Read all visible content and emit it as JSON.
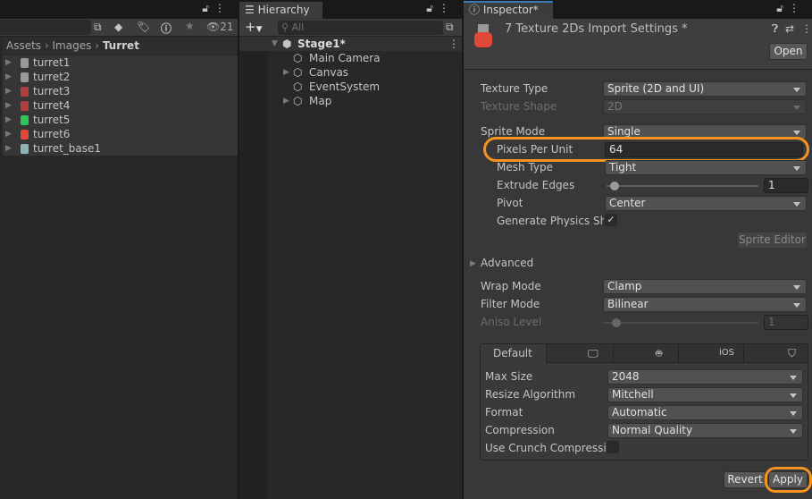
{
  "project": {
    "search_value": "",
    "hidden_count": "21",
    "breadcrumb": [
      "Assets",
      "Images",
      "Turret"
    ],
    "items": [
      {
        "label": "turret1",
        "color": "#9a9a9a"
      },
      {
        "label": "turret2",
        "color": "#9a9a9a"
      },
      {
        "label": "turret3",
        "color": "#b04040"
      },
      {
        "label": "turret4",
        "color": "#b04040"
      },
      {
        "label": "turret5",
        "color": "#2ec458"
      },
      {
        "label": "turret6",
        "color": "#e0483a"
      },
      {
        "label": "turret_base1",
        "color": "#8fb3b3"
      }
    ]
  },
  "hierarchy": {
    "tab": "Hierarchy",
    "search_placeholder": "All",
    "scene": "Stage1*",
    "objects": [
      {
        "label": "Main Camera",
        "expandable": false
      },
      {
        "label": "Canvas",
        "expandable": true
      },
      {
        "label": "EventSystem",
        "expandable": false
      },
      {
        "label": "Map",
        "expandable": true
      }
    ]
  },
  "inspector": {
    "tab": "Inspector*",
    "title": "7 Texture 2Ds Import Settings *",
    "open": "Open",
    "texture_type": {
      "label": "Texture Type",
      "value": "Sprite (2D and UI)"
    },
    "texture_shape": {
      "label": "Texture Shape",
      "value": "2D"
    },
    "sprite_mode": {
      "label": "Sprite Mode",
      "value": "Single"
    },
    "ppu": {
      "label": "Pixels Per Unit",
      "value": "64"
    },
    "mesh_type": {
      "label": "Mesh Type",
      "value": "Tight"
    },
    "extrude": {
      "label": "Extrude Edges",
      "value": "1"
    },
    "pivot": {
      "label": "Pivot",
      "value": "Center"
    },
    "physics": {
      "label": "Generate Physics Shape",
      "checked": true
    },
    "sprite_editor": "Sprite Editor",
    "advanced": "Advanced",
    "wrap": {
      "label": "Wrap Mode",
      "value": "Clamp"
    },
    "filter": {
      "label": "Filter Mode",
      "value": "Bilinear"
    },
    "aniso": {
      "label": "Aniso Level",
      "value": "1"
    },
    "platform_tabs": [
      "Default",
      "standalone-icon",
      "android-icon",
      "iOS",
      "webgl-icon"
    ],
    "max_size": {
      "label": "Max Size",
      "value": "2048"
    },
    "resize": {
      "label": "Resize Algorithm",
      "value": "Mitchell"
    },
    "format": {
      "label": "Format",
      "value": "Automatic"
    },
    "compression": {
      "label": "Compression",
      "value": "Normal Quality"
    },
    "crunch": {
      "label": "Use Crunch Compression",
      "checked": false
    },
    "revert": "Revert",
    "apply": "Apply",
    "highlight_color": "#f7931e"
  }
}
